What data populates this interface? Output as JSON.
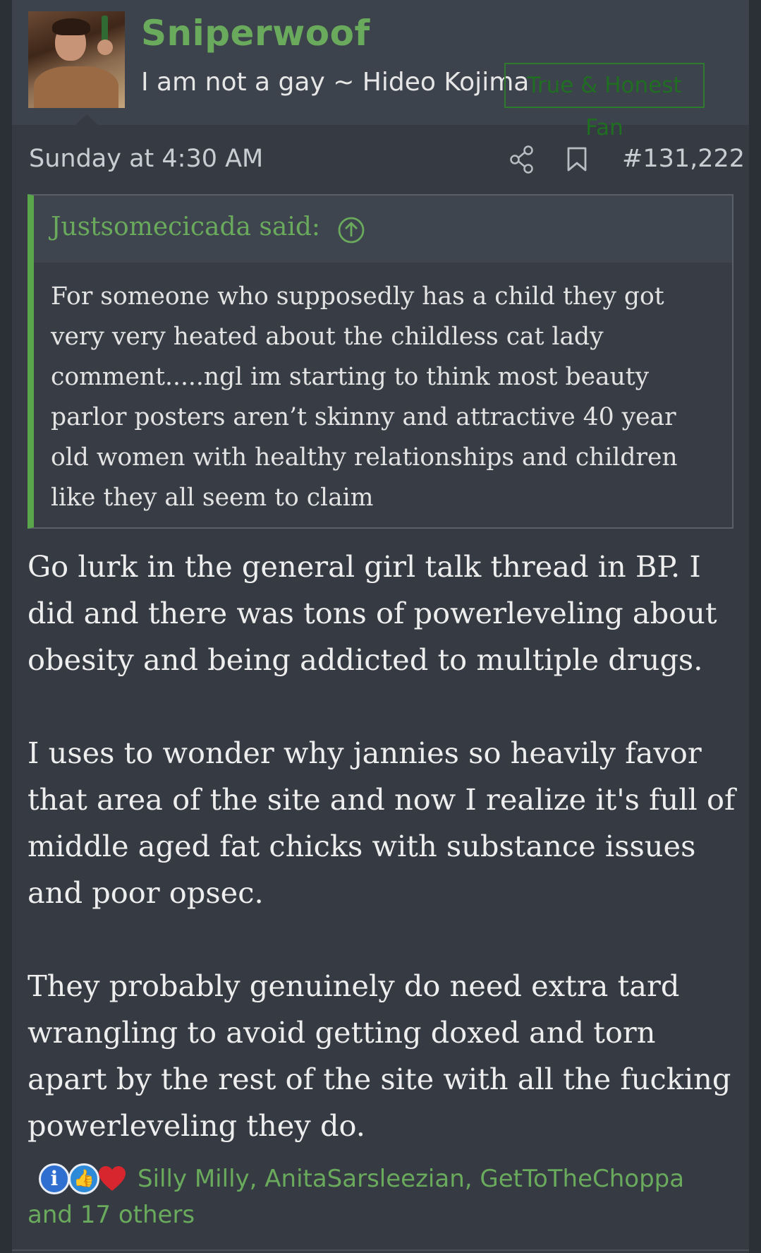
{
  "user": {
    "name": "Sniperwoof",
    "title": "I am not a gay ~ Hideo Kojima",
    "banner": "True & Honest Fan",
    "avatar_icon": "user-avatar-photo"
  },
  "post": {
    "date": "Sunday at 4:30 AM",
    "number": "#131,222",
    "share_icon": "share-icon",
    "bookmark_icon": "bookmark-icon"
  },
  "quote": {
    "author": "Justsomecicada said:",
    "jump_icon": "arrow-up-circle-icon",
    "text": "For someone who supposedly has a child they got very very heated about the childless cat lady comment.....ngl im starting to think most beauty parlor posters aren’t skinny and attractive 40 year old women with healthy relationships and children like they all seem to claim"
  },
  "body": {
    "p1": "Go lurk in the general girl talk thread in BP. I did and there was tons of powerleveling about obesity and being addicted to multiple drugs.",
    "p2": "I uses to wonder why jannies so heavily favor that area of the site and now I realize it's full of middle aged fat chicks with substance issues and poor opsec.",
    "p3": "They probably genuinely do need extra tard wrangling to avoid getting doxed and torn apart by the rest of the site with all the fucking powerleveling they do."
  },
  "reactions": {
    "icons": [
      "informative-icon",
      "like-icon",
      "love-icon"
    ],
    "text": "Silly Milly, AnitaSarsleezian, GetToTheChoppa and 17 others"
  },
  "colors": {
    "accent_green": "#6aaa5c",
    "banner_green": "#1f6e22",
    "quote_bar": "#5aa64a",
    "background": "#363b43"
  }
}
